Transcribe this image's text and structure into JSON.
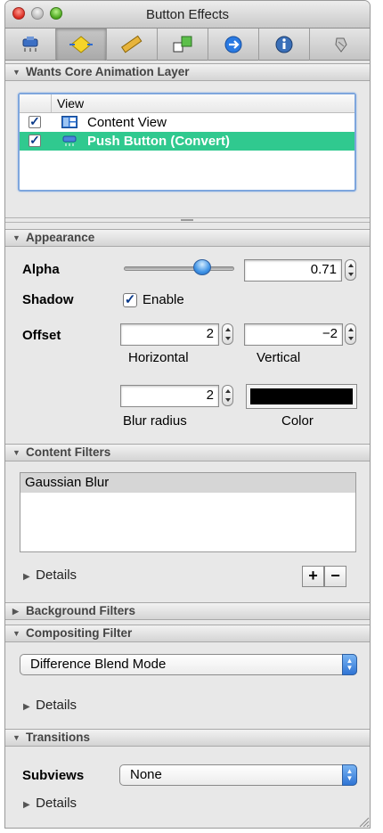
{
  "window": {
    "title": "Button Effects"
  },
  "toolbar": {
    "tabs": [
      {
        "icon": "attributes-icon"
      },
      {
        "icon": "effects-icon",
        "active": true
      },
      {
        "icon": "size-ruler-icon"
      },
      {
        "icon": "connections-icon"
      },
      {
        "icon": "bindings-arrow-icon"
      },
      {
        "icon": "info-icon"
      },
      {
        "icon": "applescript-icon"
      }
    ]
  },
  "layer_section": {
    "header": "Wants Core Animation Layer",
    "column_header": "View",
    "rows": [
      {
        "label": "Content View",
        "checked": true,
        "selected": false
      },
      {
        "label": "Push Button (Convert)",
        "checked": true,
        "selected": true
      }
    ]
  },
  "appearance": {
    "header": "Appearance",
    "alpha_label": "Alpha",
    "alpha_value": "0.71",
    "alpha_slider_fraction": 0.71,
    "shadow_label": "Shadow",
    "enable_label": "Enable",
    "enable_checked": true,
    "offset_label": "Offset",
    "horizontal_value": "2",
    "horizontal_label": "Horizontal",
    "vertical_value": "−2",
    "vertical_label": "Vertical",
    "blur_value": "2",
    "blur_label": "Blur radius",
    "color_label": "Color",
    "shadow_color": "#000000"
  },
  "content_filters": {
    "header": "Content Filters",
    "items": [
      "Gaussian Blur"
    ],
    "details_label": "Details",
    "add_label": "+",
    "remove_label": "−"
  },
  "background_filters": {
    "header": "Background Filters"
  },
  "compositing_filter": {
    "header": "Compositing Filter",
    "selected": "Difference Blend Mode",
    "details_label": "Details"
  },
  "transitions": {
    "header": "Transitions",
    "subviews_label": "Subviews",
    "subviews_value": "None",
    "details_label": "Details"
  },
  "colors": {
    "selection_green": "#30c98f",
    "focus_blue": "#7ea6dd"
  }
}
